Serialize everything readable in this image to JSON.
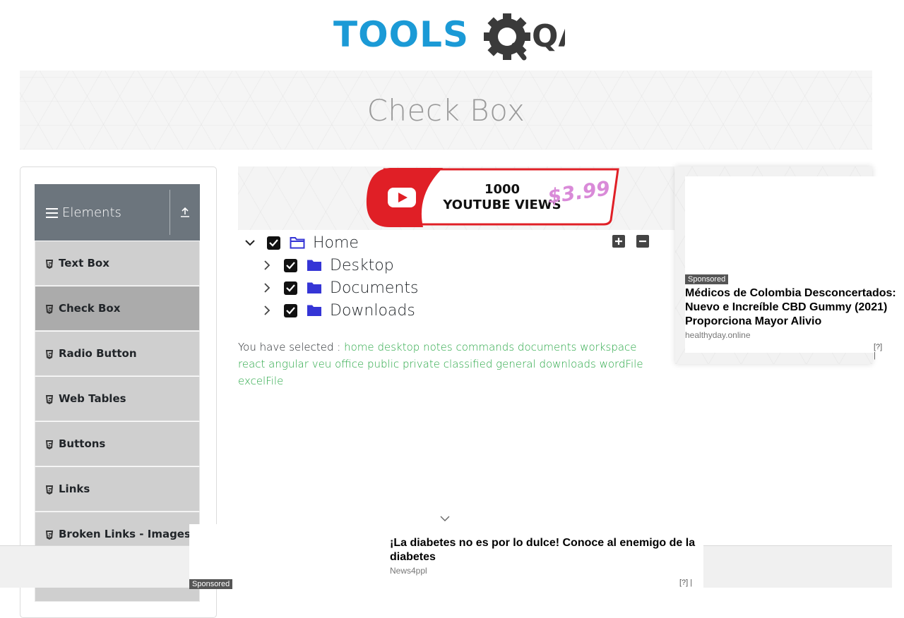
{
  "logo": {
    "text_blue": "TOOLS",
    "text_dark": "QA",
    "accent": "#1b9ad6"
  },
  "banner": {
    "title": "Check Box"
  },
  "sidebar": {
    "group_title": "Elements",
    "items": [
      {
        "label": "Text Box",
        "active": false
      },
      {
        "label": "Check Box",
        "active": true
      },
      {
        "label": "Radio Button",
        "active": false
      },
      {
        "label": "Web Tables",
        "active": false
      },
      {
        "label": "Buttons",
        "active": false
      },
      {
        "label": "Links",
        "active": false
      },
      {
        "label": "Broken Links - Images",
        "active": false
      }
    ]
  },
  "promo_banner": {
    "line1": "1000",
    "line2": "YOUTUBE VIEWS",
    "price": "$3.99"
  },
  "tree": {
    "root": {
      "label": "Home",
      "checked": true,
      "expanded": true
    },
    "children": [
      {
        "label": "Desktop",
        "checked": true
      },
      {
        "label": "Documents",
        "checked": true
      },
      {
        "label": "Downloads",
        "checked": true
      }
    ],
    "expand_all_icon": "plus-square-icon",
    "collapse_all_icon": "minus-square-icon"
  },
  "result": {
    "prefix": "You have selected :",
    "items": [
      "home",
      "desktop",
      "notes",
      "commands",
      "documents",
      "workspace",
      "react",
      "angular",
      "veu",
      "office",
      "public",
      "private",
      "classified",
      "general",
      "downloads",
      "wordFile",
      "excelFile"
    ],
    "item_color": "#28a745"
  },
  "right_ad": {
    "badge": "Sponsored",
    "title_line1": "Médicos de Colombia Desconcertados:",
    "title_line2": "Nuevo e Increíble CBD Gummy (2021)",
    "title_line3": "Proporciona Mayor Alivio",
    "source": "healthyday.online",
    "flag": "[?]"
  },
  "bottom_ad": {
    "badge": "Sponsored",
    "title_line1": "¡La diabetes no es por lo dulce! Conoce al enemigo de la",
    "title_line2": "diabetes",
    "source": "News4ppl",
    "flag": "[?]"
  }
}
